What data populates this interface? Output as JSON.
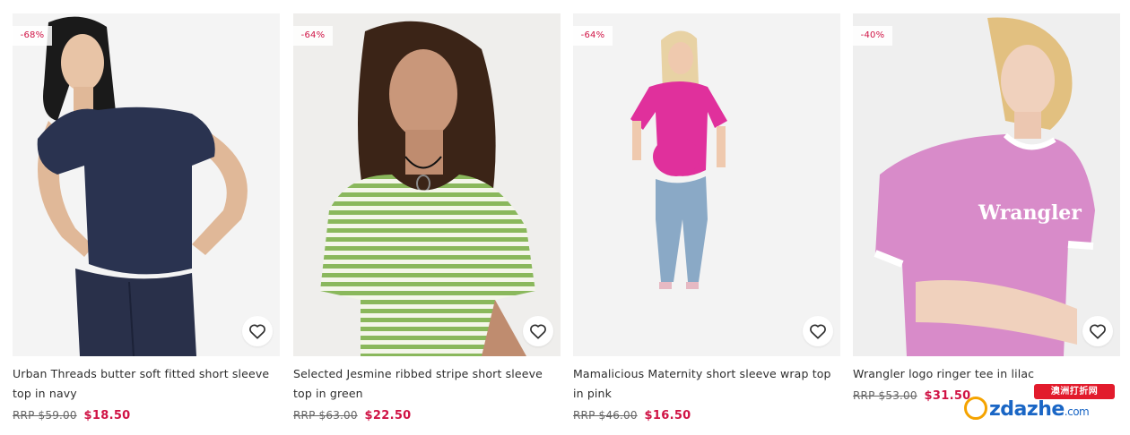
{
  "products": [
    {
      "discount": "-68%",
      "title": "Urban Threads butter soft fitted short sleeve top in navy",
      "rrp": "RRP $59.00",
      "price": "$18.50"
    },
    {
      "discount": "-64%",
      "title": "Selected Jesmine ribbed stripe short sleeve top in green",
      "rrp": "RRP $63.00",
      "price": "$22.50"
    },
    {
      "discount": "-64%",
      "title": "Mamalicious Maternity short sleeve wrap top in pink",
      "rrp": "RRP $46.00",
      "price": "$16.50"
    },
    {
      "discount": "-40%",
      "title": "Wrangler logo ringer tee in lilac",
      "rrp": "RRP $53.00",
      "price": "$31.50",
      "shirt_print": "Wrangler"
    }
  ],
  "watermark": {
    "cn_text": "澳洲打折网",
    "logo_text": "zdazhe",
    "logo_suffix": ".com"
  },
  "icons": {
    "favorite": "heart-outline-icon"
  },
  "colors": {
    "sale": "#d01345",
    "rrp": "#666666",
    "text": "#2d2d2d"
  }
}
